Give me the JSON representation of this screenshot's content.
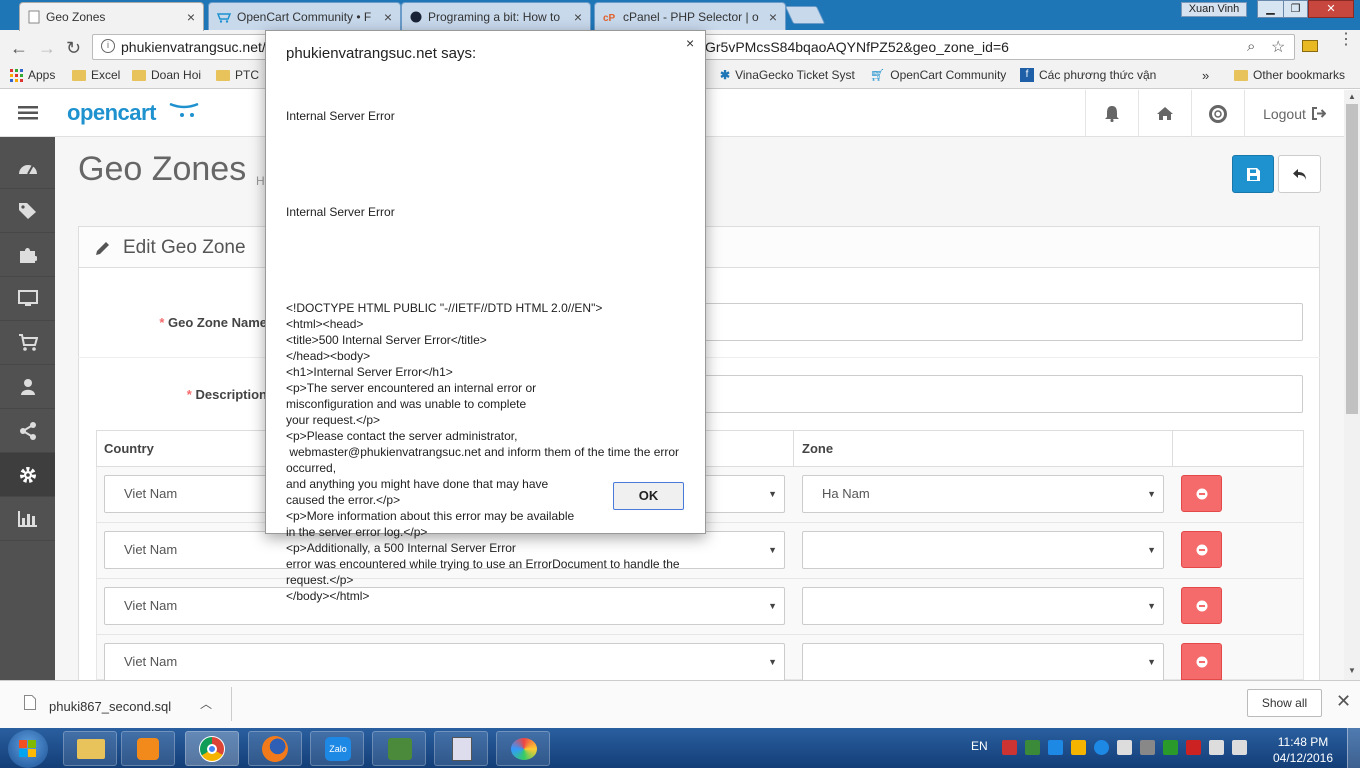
{
  "browser": {
    "tabs": [
      {
        "title": "Geo Zones",
        "active": true
      },
      {
        "title": "OpenCart Community • F",
        "active": false
      },
      {
        "title": "Programing a bit: How to",
        "active": false
      },
      {
        "title": "cPanel - PHP Selector | o",
        "active": false
      }
    ],
    "user": "Xuan Vinh",
    "url_start": "phukienvatrangsuc.net/",
    "url_end": "Gr5vPMcsS84bqaoAQYNfPZ52&geo_zone_id=6",
    "bookmarks": [
      {
        "label": "Apps"
      },
      {
        "label": "Excel"
      },
      {
        "label": "Doan Hoi"
      },
      {
        "label": "PTC"
      },
      {
        "label": "VinaGecko Ticket Syst"
      },
      {
        "label": "OpenCart Community"
      },
      {
        "label": "Các phương thức vận"
      }
    ],
    "more_bookmarks": "»",
    "other_bookmarks": "Other bookmarks"
  },
  "header": {
    "logo": "opencart",
    "logout": "Logout"
  },
  "page": {
    "title": "Geo Zones",
    "breadcrumb": "H"
  },
  "form": {
    "panel_title": "Edit Geo Zone",
    "name_label": "Geo Zone Name",
    "description_label": "Description",
    "required_mark": "*",
    "table_headers": {
      "country": "Country",
      "zone": "Zone"
    },
    "rows": [
      {
        "country": "Viet Nam",
        "zone": "Ha Nam"
      },
      {
        "country": "Viet Nam",
        "zone": ""
      },
      {
        "country": "Viet Nam",
        "zone": ""
      },
      {
        "country": "Viet Nam",
        "zone": ""
      }
    ]
  },
  "downloads": {
    "file": "phuki867_second.sql",
    "show_all": "Show all"
  },
  "taskbar": {
    "lang": "EN",
    "time": "11:48 PM",
    "date": "04/12/2016"
  },
  "dialog": {
    "title": "phukienvatrangsuc.net says:",
    "line1": "Internal Server Error",
    "line2": "Internal Server Error",
    "body": "<!DOCTYPE HTML PUBLIC \"-//IETF//DTD HTML 2.0//EN\">\n<html><head>\n<title>500 Internal Server Error</title>\n</head><body>\n<h1>Internal Server Error</h1>\n<p>The server encountered an internal error or\nmisconfiguration and was unable to complete\nyour request.</p>\n<p>Please contact the server administrator,\n webmaster@phukienvatrangsuc.net and inform them of the time the error occurred,\nand anything you might have done that may have\ncaused the error.</p>\n<p>More information about this error may be available\nin the server error log.</p>\n<p>Additionally, a 500 Internal Server Error\nerror was encountered while trying to use an ErrorDocument to handle the request.</p>\n</body></html>",
    "ok": "OK"
  },
  "colors": {
    "primary": "#1e91cf",
    "danger": "#f56b6b",
    "sidebar": "#515151",
    "tabbar": "#1e76b7"
  }
}
